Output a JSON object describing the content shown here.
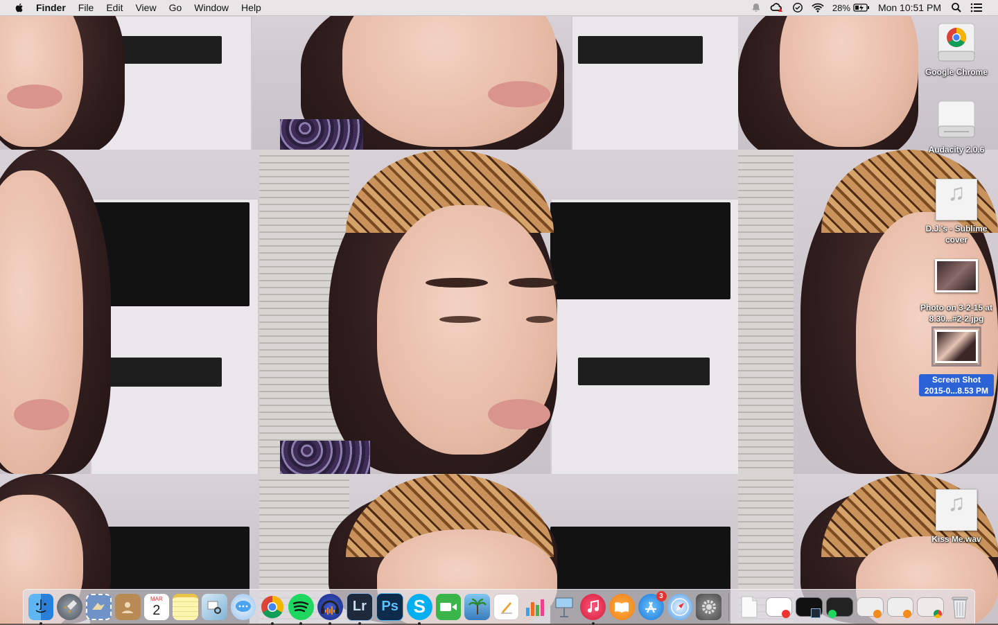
{
  "menubar": {
    "app_name": "Finder",
    "menus": [
      "File",
      "Edit",
      "View",
      "Go",
      "Window",
      "Help"
    ],
    "battery_percent": "28%",
    "clock": "Mon 10:51 PM"
  },
  "desktop_icons": [
    {
      "label": "Google Chrome",
      "kind": "drive-chrome"
    },
    {
      "label": "Audacity 2.0.6",
      "kind": "drive"
    },
    {
      "label": "D.J.'s - Sublime cover",
      "kind": "music"
    },
    {
      "label": "Photo on 3-2-15 at 8.30...#2-2.jpg",
      "kind": "photo"
    },
    {
      "label": "Screen Shot 2015-0...8.53 PM",
      "kind": "photo",
      "selected": true
    },
    {
      "label": "Kiss Me.wav",
      "kind": "music"
    }
  ],
  "dock": {
    "apps": [
      {
        "name": "finder",
        "running": true
      },
      {
        "name": "launchpad"
      },
      {
        "name": "mail-stamp"
      },
      {
        "name": "contacts"
      },
      {
        "name": "calendar",
        "month": "MAR",
        "day": "2"
      },
      {
        "name": "notes"
      },
      {
        "name": "preview"
      },
      {
        "name": "messages"
      },
      {
        "name": "chrome",
        "running": true
      },
      {
        "name": "spotify",
        "running": true
      },
      {
        "name": "audacity",
        "running": true
      },
      {
        "name": "lightroom",
        "text": "Lr",
        "running": true
      },
      {
        "name": "photoshop",
        "text": "Ps"
      },
      {
        "name": "skype",
        "text": "S",
        "running": true
      },
      {
        "name": "facetime"
      },
      {
        "name": "iphoto"
      },
      {
        "name": "pages"
      },
      {
        "name": "numbers"
      },
      {
        "name": "keynote"
      },
      {
        "name": "itunes",
        "running": true
      },
      {
        "name": "ibooks"
      },
      {
        "name": "app-store",
        "badge": "3"
      },
      {
        "name": "safari"
      },
      {
        "name": "system-preferences"
      }
    ],
    "stacks": [
      {
        "name": "documents"
      },
      {
        "name": "window-1"
      },
      {
        "name": "window-2"
      },
      {
        "name": "window-3"
      },
      {
        "name": "window-4"
      },
      {
        "name": "window-5"
      },
      {
        "name": "window-6"
      },
      {
        "name": "trash"
      }
    ]
  },
  "colors": {
    "selection": "#2b63d6",
    "menubar_bg": "#eeecee"
  }
}
